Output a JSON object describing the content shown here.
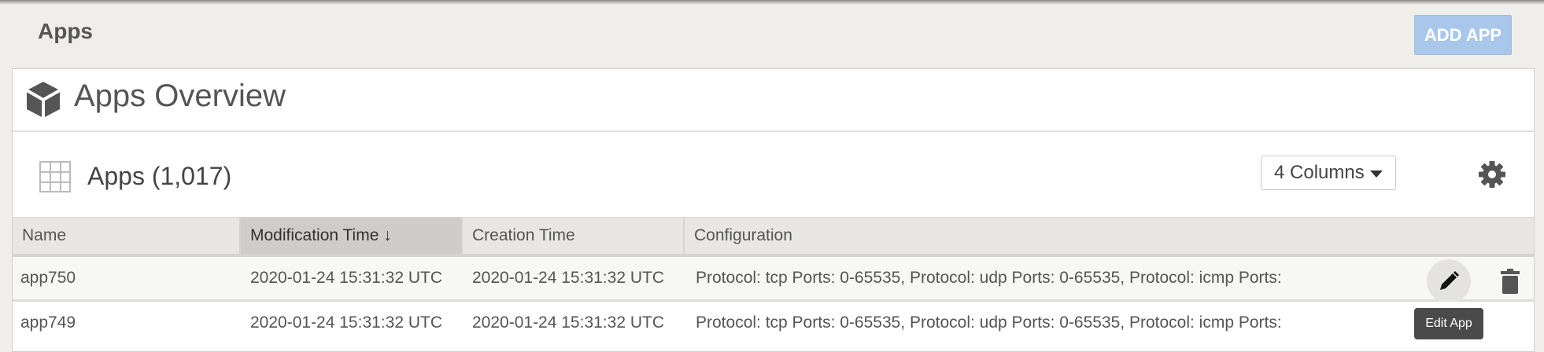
{
  "header": {
    "title": "Apps",
    "add_button": "ADD APP"
  },
  "overview": {
    "title": "Apps Overview",
    "icon": "cube-icon"
  },
  "apps_section": {
    "title": "Apps (1,017)",
    "columns_select": "4 Columns",
    "settings_icon": "gear-icon"
  },
  "table": {
    "columns": [
      {
        "label": "Name"
      },
      {
        "label": "Modification Time ↓"
      },
      {
        "label": "Creation Time"
      },
      {
        "label": "Configuration"
      }
    ],
    "rows": [
      {
        "name": "app750",
        "modified": "2020-01-24 15:31:32 UTC",
        "created": "2020-01-24 15:31:32 UTC",
        "configuration": "Protocol: tcp Ports: 0-65535, Protocol: udp Ports: 0-65535, Protocol: icmp Ports:"
      },
      {
        "name": "app749",
        "modified": "2020-01-24 15:31:32 UTC",
        "created": "2020-01-24 15:31:32 UTC",
        "configuration": "Protocol: tcp Ports: 0-65535, Protocol: udp Ports: 0-65535, Protocol: icmp Ports:"
      }
    ]
  },
  "tooltip": {
    "text": "Edit App"
  },
  "colors": {
    "accent": "#a9c7ea",
    "background": "#f0eeeb",
    "sorted_header": "#cfcdca"
  }
}
